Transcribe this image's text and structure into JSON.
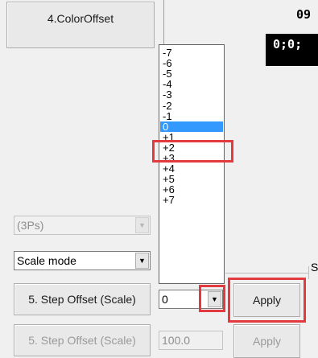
{
  "buttons": {
    "color_offset": "4.ColorOffset",
    "step_offset_scale": "5. Step Offset (Scale)",
    "apply": "Apply",
    "step_offset_scale_faded": "5. Step Offset (Scale)",
    "apply_faded": "Apply"
  },
  "display": {
    "number_label": "09",
    "black_box_text": "0;0;"
  },
  "combos": {
    "ps_combo_value": "(3Ps)",
    "scale_mode_value": "Scale mode",
    "step_offset_value": "0",
    "faded_value": "100.0"
  },
  "group_label": "S",
  "dropdown": {
    "options": [
      "-7",
      "-6",
      "-5",
      "-4",
      "-3",
      "-2",
      "-1",
      "0",
      "+1",
      "+2",
      "+3",
      "+4",
      "+5",
      "+6",
      "+7"
    ],
    "selected_index": 7,
    "highlighted_index": 6
  },
  "colors": {
    "highlight": "#e23a3f",
    "selection": "#3399ff"
  }
}
